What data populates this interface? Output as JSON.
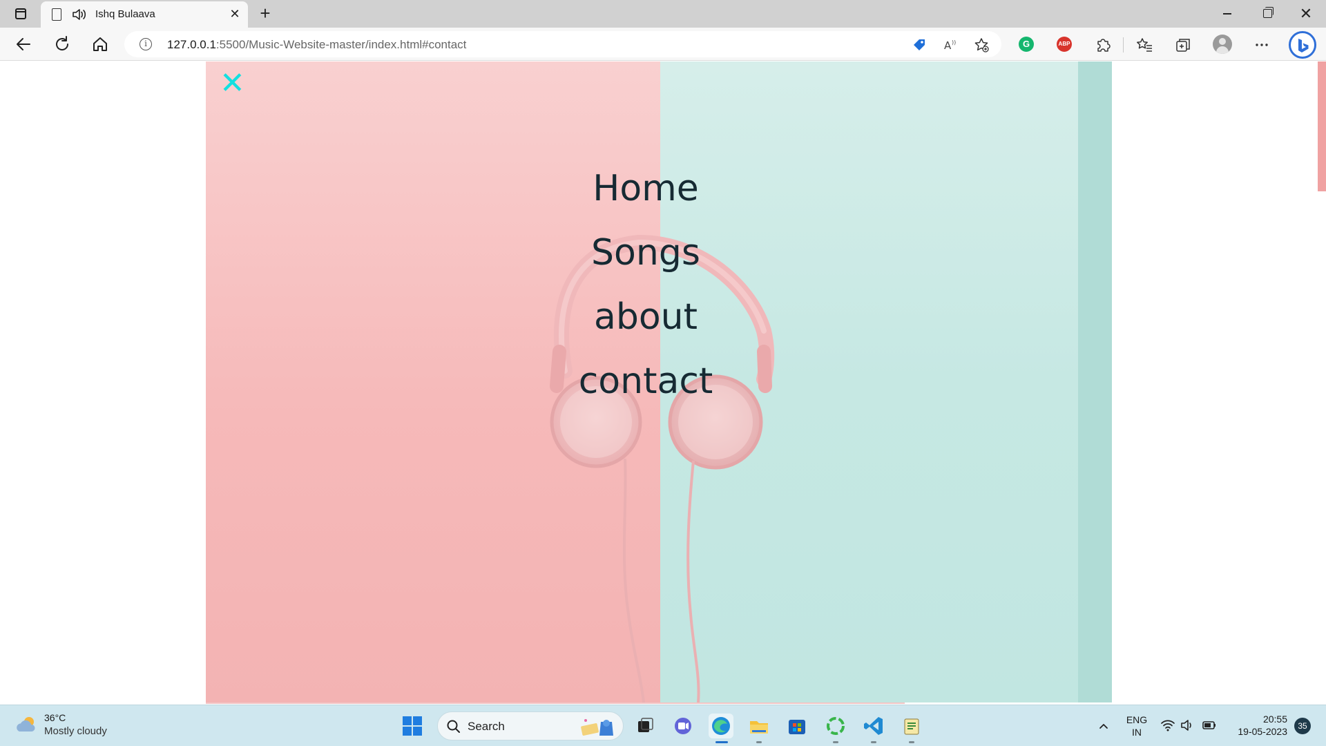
{
  "browser": {
    "tab": {
      "title": "Ishq Bulaava",
      "close_glyph": "✕"
    },
    "new_tab_glyph": "+",
    "address": {
      "host": "127.0.0.1",
      "path": ":5500/Music-Website-master/index.html#contact"
    },
    "close_glyph": "✕"
  },
  "page": {
    "close_menu_glyph": "✕",
    "menu": [
      {
        "label": "Home"
      },
      {
        "label": "Songs"
      },
      {
        "label": "about"
      },
      {
        "label": "contact"
      }
    ],
    "colors": {
      "accent": "#14e0e0",
      "menu_text": "#162a33",
      "pink": "#f6b9b9",
      "mint": "#c6e8e3"
    }
  },
  "taskbar": {
    "weather": {
      "temp": "36°C",
      "desc": "Mostly cloudy"
    },
    "search_label": "Search",
    "language": {
      "line1": "ENG",
      "line2": "IN"
    },
    "clock": {
      "time": "20:55",
      "date": "19-05-2023"
    },
    "notifications": "35",
    "tray_glyph": "^"
  },
  "icons": {
    "sidebar_toggle": "tab-actions-icon",
    "back": "back-arrow-icon",
    "reload": "reload-icon",
    "home": "home-icon",
    "favorites_add": "favorite-add-icon",
    "extensions": "puzzle-icon",
    "collections": "collections-icon",
    "more": "more-icon"
  }
}
